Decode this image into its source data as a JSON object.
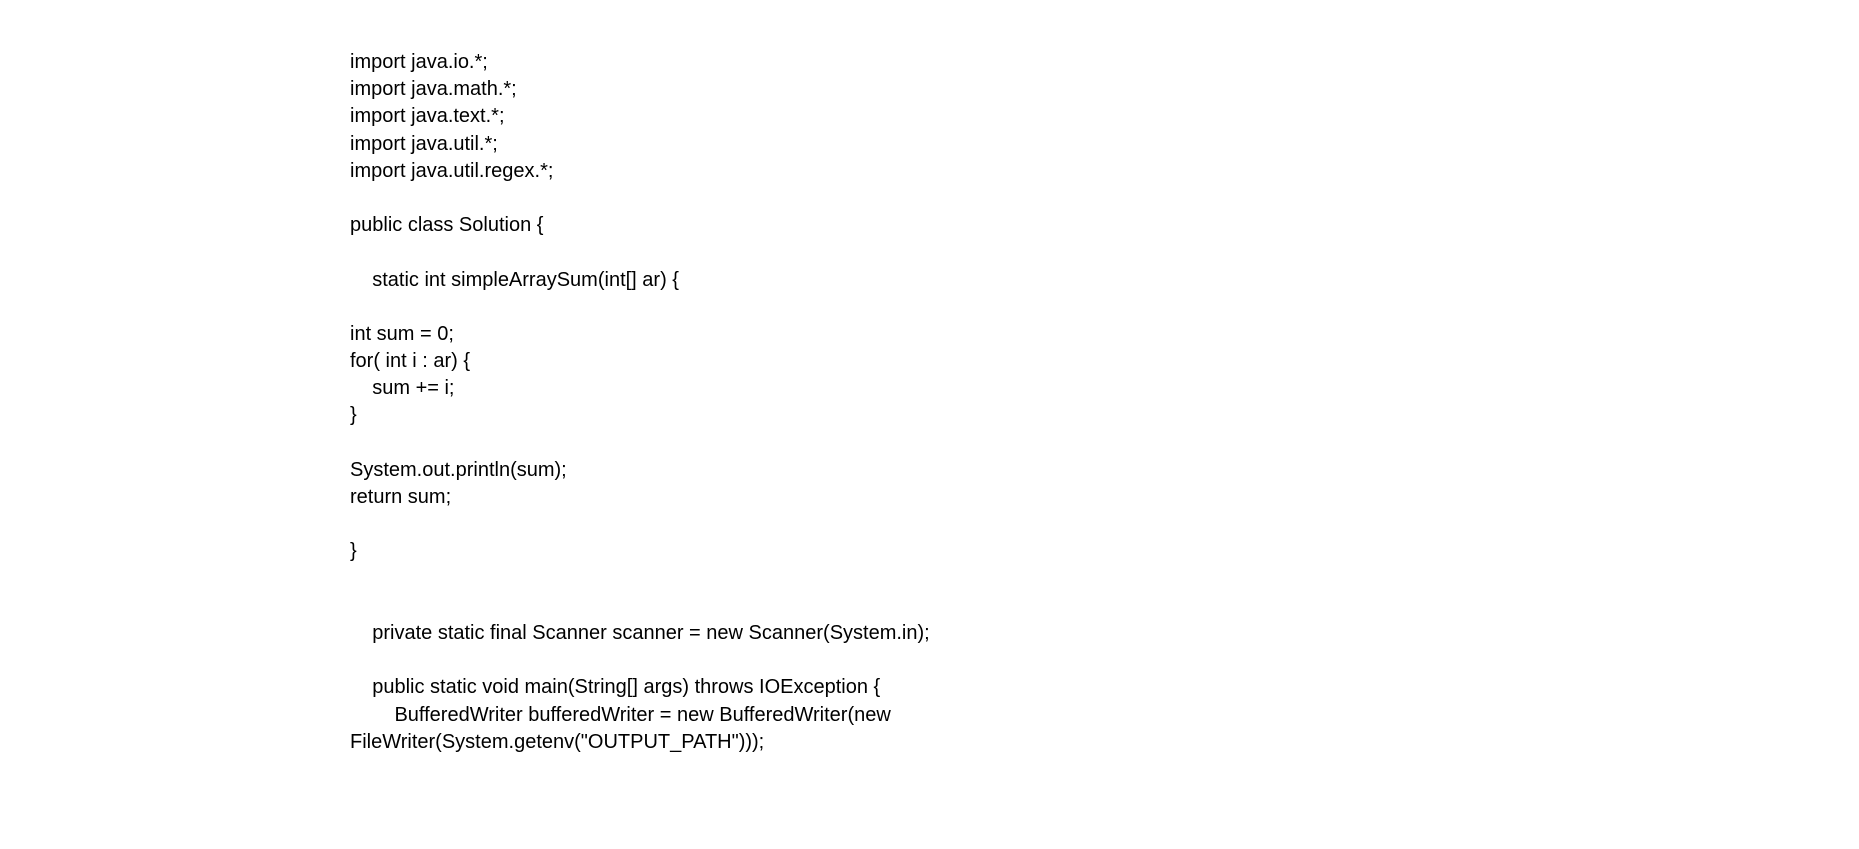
{
  "document": {
    "lines": [
      "import java.io.*;",
      "import java.math.*;",
      "import java.text.*;",
      "import java.util.*;",
      "import java.util.regex.*;",
      "",
      "public class Solution {",
      "",
      "    static int simpleArraySum(int[] ar) {",
      "",
      "int sum = 0;",
      "for( int i : ar) {",
      "    sum += i;",
      "}",
      "",
      "System.out.println(sum);",
      "return sum;",
      "",
      "}",
      "",
      "",
      "    private static final Scanner scanner = new Scanner(System.in);",
      "",
      "    public static void main(String[] args) throws IOException {",
      "        BufferedWriter bufferedWriter = new BufferedWriter(new",
      "FileWriter(System.getenv(\"OUTPUT_PATH\")));"
    ]
  }
}
